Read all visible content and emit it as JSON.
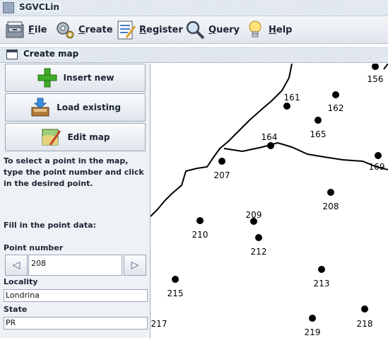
{
  "window": {
    "title": "SGVCLin"
  },
  "menu": [
    {
      "label": "File",
      "icon": "file-cabinet-icon"
    },
    {
      "label": "Create",
      "icon": "gears-icon"
    },
    {
      "label": "Register",
      "icon": "form-icon"
    },
    {
      "label": "Query",
      "icon": "magnifier-icon"
    },
    {
      "label": "Help",
      "icon": "lightbulb-icon"
    }
  ],
  "internal_frame": {
    "title": "Create map"
  },
  "buttons": {
    "insert_new": "Insert new",
    "load_existing": "Load existing",
    "edit_map": "Edit map"
  },
  "instructions": "To select a point in the map, type the point number and click in the desired point.",
  "fill_prompt": "Fill in the point data:",
  "point_number": {
    "label": "Point number",
    "value": "208"
  },
  "locality": {
    "label": "Locality",
    "value": "Londrina"
  },
  "state": {
    "label": "State",
    "value": "PR"
  },
  "map_points": [
    "156",
    "161",
    "162",
    "165",
    "164",
    "169",
    "207",
    "208",
    "209",
    "210",
    "212",
    "213",
    "215",
    "217",
    "218",
    "219"
  ],
  "colors": {
    "accent_green": "#3fae2a",
    "marker": "#000000"
  }
}
